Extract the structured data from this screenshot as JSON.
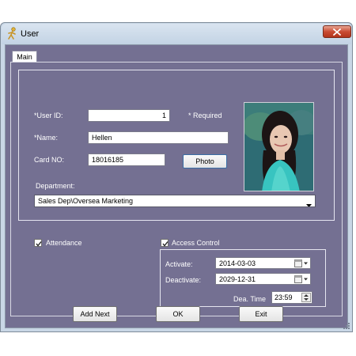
{
  "window": {
    "title": "User",
    "close_symbol": "✕",
    "icons": {
      "app": "user-figure-icon",
      "close": "close-icon",
      "resize": "resize-grip-icon"
    }
  },
  "tabs": [
    {
      "label": "Main",
      "selected": true
    }
  ],
  "form": {
    "user_id_label": "*User ID:",
    "user_id_value": "1",
    "required_note": "* Required",
    "name_label": "*Name:",
    "name_value": "Hellen",
    "card_no_label": "Card NO:",
    "card_no_value": "18016185",
    "photo_button_label": "Photo",
    "department_label": "Department:",
    "department_value": "Sales Dep\\Oversea Marketing"
  },
  "options": {
    "attendance_label": "Attendance",
    "attendance_checked": true,
    "access_control_label": "Access Control",
    "access_control_checked": true
  },
  "access": {
    "activate_label": "Activate:",
    "activate_value": "2014-03-03",
    "deactivate_label": "Deactivate:",
    "deactivate_value": "2029-12-31",
    "dea_time_label": "Dea. Time",
    "dea_time_value": "23:59"
  },
  "footer": {
    "add_next_label": "Add Next",
    "ok_label": "OK",
    "exit_label": "Exit"
  },
  "colors": {
    "panel_background": "#747092",
    "window_frame": "#c9d7e6",
    "close_button": "#c94b32"
  }
}
